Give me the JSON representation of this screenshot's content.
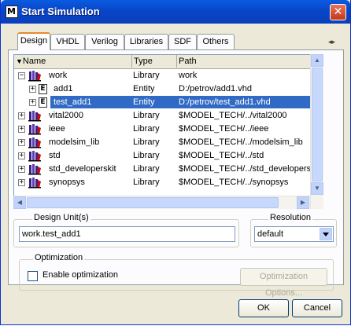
{
  "window": {
    "title": "Start Simulation",
    "close_label": "✕",
    "icon_label": "M"
  },
  "tabs": [
    "Design",
    "VHDL",
    "Verilog",
    "Libraries",
    "SDF",
    "Others"
  ],
  "tab_scroll": {
    "left": "◂",
    "right": "▸"
  },
  "columns": [
    "Name",
    "Type",
    "Path"
  ],
  "rows": [
    {
      "expander": "−",
      "icon": "library",
      "name": "work",
      "type": "Library",
      "path": "work"
    },
    {
      "expander": "+",
      "icon": "entity",
      "name": "add1",
      "type": "Entity",
      "path": "D:/petrov/add1.vhd"
    },
    {
      "expander": "+",
      "icon": "entity",
      "name": "test_add1",
      "type": "Entity",
      "path": "D:/petrov/test_add1.vhd"
    },
    {
      "expander": "+",
      "icon": "library",
      "name": "vital2000",
      "type": "Library",
      "path": "$MODEL_TECH/../vital2000"
    },
    {
      "expander": "+",
      "icon": "library",
      "name": "ieee",
      "type": "Library",
      "path": "$MODEL_TECH/../ieee"
    },
    {
      "expander": "+",
      "icon": "library",
      "name": "modelsim_lib",
      "type": "Library",
      "path": "$MODEL_TECH/../modelsim_lib"
    },
    {
      "expander": "+",
      "icon": "library",
      "name": "std",
      "type": "Library",
      "path": "$MODEL_TECH/../std"
    },
    {
      "expander": "+",
      "icon": "library",
      "name": "std_developerskit",
      "type": "Library",
      "path": "$MODEL_TECH/../std_developerskit"
    },
    {
      "expander": "+",
      "icon": "library",
      "name": "synopsys",
      "type": "Library",
      "path": "$MODEL_TECH/../synopsys"
    }
  ],
  "design_unit": {
    "label": "Design Unit(s)",
    "value": "work.test_add1"
  },
  "resolution": {
    "label": "Resolution",
    "value": "default"
  },
  "optimization": {
    "label": "Optimization",
    "checkbox_label": "Enable optimization",
    "options_button": "Optimization Options..."
  },
  "buttons": {
    "ok": "OK",
    "cancel": "Cancel"
  },
  "colors": {
    "selection": "#316ac5",
    "titlebar": "#0a5be0",
    "active_tab_accent": "#e68b2c"
  }
}
